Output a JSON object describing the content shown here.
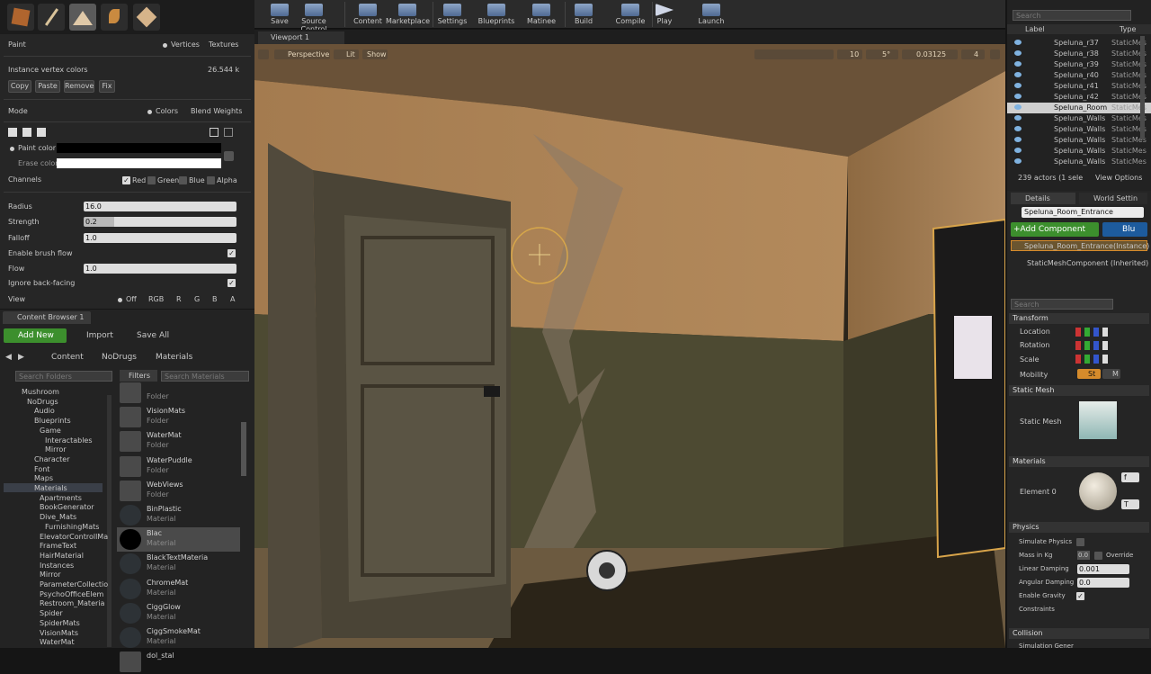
{
  "toolbar": {
    "items": [
      "Save",
      "Source Control",
      "Content",
      "Marketplace",
      "Settings",
      "Blueprints",
      "Matinee",
      "Build",
      "Compile",
      "Play",
      "Launch"
    ]
  },
  "paint": {
    "title": "Paint",
    "radio_vertices": "Vertices",
    "radio_textures": "Textures",
    "instance_label": "Instance vertex colors",
    "instance_value": "26.544 k",
    "btn_copy": "Copy",
    "btn_paste": "Paste",
    "btn_remove": "Remove",
    "btn_fix": "Fix",
    "mode_label": "Mode",
    "mode_colors": "Colors",
    "mode_blend": "Blend Weights",
    "paint_color": "Paint color",
    "erase_color": "Erase color",
    "channels_label": "Channels",
    "ch_red": "Red",
    "ch_green": "Green",
    "ch_blue": "Blue",
    "ch_alpha": "Alpha",
    "radius_label": "Radius",
    "radius_value": "16.0",
    "strength_label": "Strength",
    "strength_value": "0.2",
    "falloff_label": "Falloff",
    "falloff_value": "1.0",
    "enable_flow": "Enable brush flow",
    "flow_label": "Flow",
    "flow_value": "1.0",
    "ignore_back": "Ignore back-facing",
    "view_label": "View",
    "view_off": "Off",
    "view_rgb": "RGB",
    "view_r": "R",
    "view_g": "G",
    "view_b": "B",
    "view_a": "A"
  },
  "content_browser": {
    "tab": "Content Browser 1",
    "add_new": "Add New",
    "import": "Import",
    "save_all": "Save All",
    "path": [
      "Content",
      "NoDrugs",
      "Materials"
    ],
    "search_folders": "Search Folders",
    "filters": "Filters",
    "search_materials": "Search Materials",
    "tree": [
      "Mushroom",
      "NoDrugs",
      "Audio",
      "Blueprints",
      "Game",
      "Interactables",
      "Mirror",
      "Character",
      "Font",
      "Maps",
      "Materials",
      "Apartments",
      "BookGenerator",
      "Dive_Mats",
      "FurnishingMats",
      "ElevatorControllMa",
      "FrameText",
      "HairMaterial",
      "Instances",
      "Mirror",
      "ParameterCollectio",
      "PsychoOfficeElem",
      "Restroom_Materia",
      "Spider",
      "SpiderMats",
      "VisionMats",
      "WaterMat"
    ],
    "assets": [
      {
        "name": "",
        "type": "Folder"
      },
      {
        "name": "VisionMats",
        "type": "Folder"
      },
      {
        "name": "WaterMat",
        "type": "Folder"
      },
      {
        "name": "WaterPuddle",
        "type": "Folder"
      },
      {
        "name": "WebViews",
        "type": "Folder"
      },
      {
        "name": "BinPlastic",
        "type": "Material"
      },
      {
        "name": "Blac",
        "type": "Material"
      },
      {
        "name": "BlackTextMateria",
        "type": "Material"
      },
      {
        "name": "ChromeMat",
        "type": "Material"
      },
      {
        "name": "CiggGlow",
        "type": "Material"
      },
      {
        "name": "CiggSmokeMat",
        "type": "Material"
      },
      {
        "name": "dol_stal",
        "type": ""
      }
    ]
  },
  "viewport": {
    "tab": "Viewport 1",
    "perspective": "Perspective",
    "lit": "Lit",
    "show": "Show",
    "grid_value": "10",
    "rot_value": "5°",
    "scale_value": "0.03125",
    "cam_value": "4"
  },
  "outliner": {
    "search": "Search",
    "col_label": "Label",
    "col_type": "Type",
    "rows": [
      {
        "label": "Speluna_r37",
        "type": "StaticMes"
      },
      {
        "label": "Speluna_r38",
        "type": "StaticMes"
      },
      {
        "label": "Speluna_r39",
        "type": "StaticMes"
      },
      {
        "label": "Speluna_r40",
        "type": "StaticMes"
      },
      {
        "label": "Speluna_r41",
        "type": "StaticMes"
      },
      {
        "label": "Speluna_r42",
        "type": "StaticMes"
      },
      {
        "label": "Speluna_Room",
        "type": "StaticMes"
      },
      {
        "label": "Speluna_Walls",
        "type": "StaticMes"
      },
      {
        "label": "Speluna_Walls",
        "type": "StaticMes"
      },
      {
        "label": "Speluna_Walls",
        "type": "StaticMes"
      },
      {
        "label": "Speluna_Walls",
        "type": "StaticMes"
      },
      {
        "label": "Speluna_Walls",
        "type": "StaticMes"
      }
    ],
    "footer": "239 actors (1 sele",
    "view_options": "View Options"
  },
  "details": {
    "tab_details": "Details",
    "tab_world": "World Settin",
    "name_field": "Speluna_Room_Entrance",
    "add_component": "+Add Component",
    "blueprint": "Blu",
    "instance": "Speluna_Room_Entrance(Instance)",
    "component": "StaticMeshComponent (Inherited)",
    "search": "Search",
    "transform": "Transform",
    "location": "Location",
    "rotation": "Rotation",
    "scale": "Scale",
    "mobility": "Mobility",
    "mob_st": "St",
    "mob_m": "M",
    "static_mesh_section": "Static Mesh",
    "static_mesh_label": "Static Mesh",
    "materials_section": "Materials",
    "element0": "Element 0",
    "elem_f": "f",
    "elem_t": "T",
    "physics": "Physics",
    "simulate": "Simulate Physics",
    "mass": "Mass in Kg",
    "override": "Override",
    "mass_value": "0.0",
    "linear_damping": "Linear Damping",
    "linear_value": "0.001",
    "angular_damping": "Angular Damping",
    "angular_value": "0.0",
    "enable_gravity": "Enable Gravity",
    "constraints": "Constraints",
    "collision": "Collision",
    "sim_gen": "Simulation Gener"
  },
  "colors": {
    "accent_green": "#3c8f2d",
    "accent_blue": "#1d5b9d",
    "selection_orange": "#d68b2b"
  }
}
